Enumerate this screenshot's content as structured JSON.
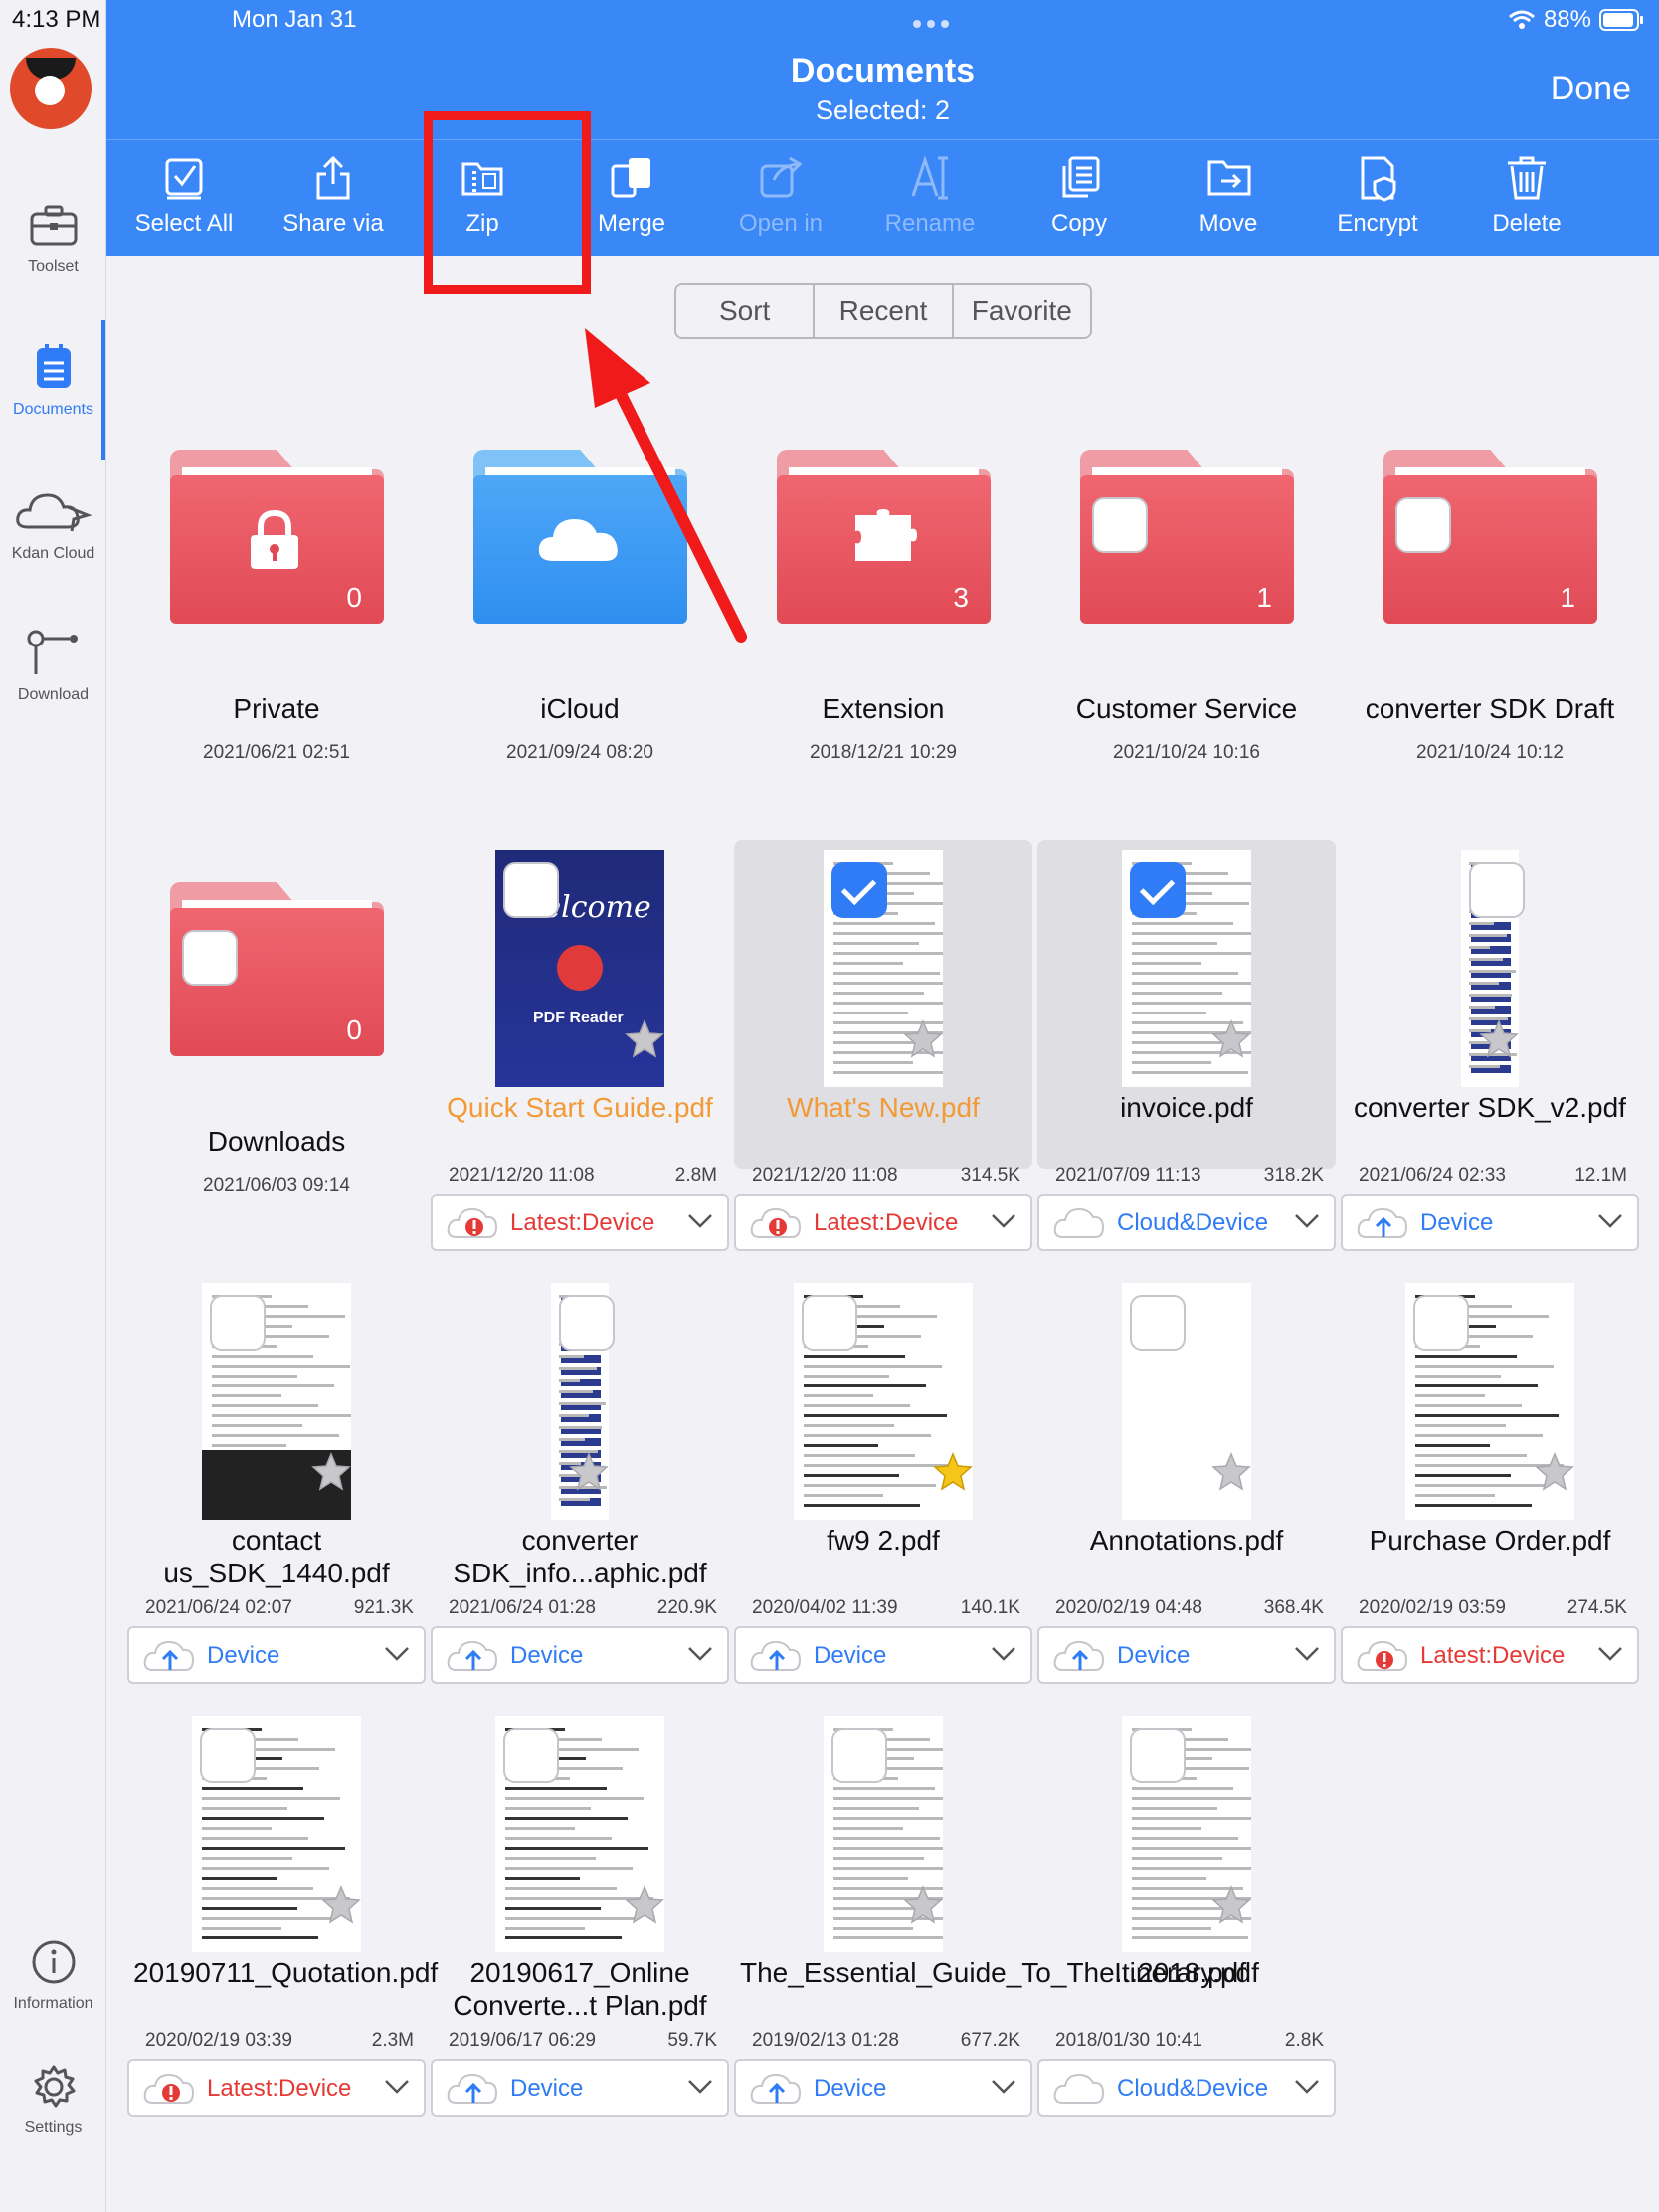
{
  "status_bar": {
    "time": "4:13 PM",
    "date": "Mon Jan 31",
    "battery": "88%"
  },
  "header": {
    "title": "Documents",
    "subtitle": "Selected: 2",
    "done_label": "Done"
  },
  "toolbar": [
    {
      "label": "Select All",
      "icon": "select-all-icon",
      "enabled": true
    },
    {
      "label": "Share via",
      "icon": "share-icon",
      "enabled": true
    },
    {
      "label": "Zip",
      "icon": "zip-icon",
      "enabled": true
    },
    {
      "label": "Merge",
      "icon": "merge-icon",
      "enabled": true
    },
    {
      "label": "Open in",
      "icon": "open-in-icon",
      "enabled": false
    },
    {
      "label": "Rename",
      "icon": "rename-icon",
      "enabled": false
    },
    {
      "label": "Copy",
      "icon": "copy-icon",
      "enabled": true
    },
    {
      "label": "Move",
      "icon": "move-icon",
      "enabled": true
    },
    {
      "label": "Encrypt",
      "icon": "encrypt-icon",
      "enabled": true
    },
    {
      "label": "Delete",
      "icon": "trash-icon",
      "enabled": true
    }
  ],
  "sort_tabs": [
    "Sort",
    "Recent",
    "Favorite"
  ],
  "sidebar": {
    "items": [
      {
        "label": "Toolset",
        "icon": "toolbox-icon"
      },
      {
        "label": "Documents",
        "icon": "documents-icon",
        "active": true
      },
      {
        "label": "Kdan Cloud",
        "icon": "cloud-icon"
      },
      {
        "label": "Download",
        "icon": "download-icon"
      },
      {
        "label": "Information",
        "icon": "info-icon"
      },
      {
        "label": "Settings",
        "icon": "gear-icon"
      }
    ]
  },
  "folders": [
    {
      "name": "Private",
      "date": "2021/06/21 02:51",
      "count": "0",
      "color": "red",
      "icon": "lock-icon"
    },
    {
      "name": "iCloud",
      "date": "2021/09/24 08:20",
      "count": "",
      "color": "blue",
      "icon": "cloud-icon"
    },
    {
      "name": "Extension",
      "date": "2018/12/21 10:29",
      "count": "3",
      "color": "red",
      "icon": "puzzle-icon"
    },
    {
      "name": "Customer Service",
      "date": "2021/10/24 10:16",
      "count": "1",
      "color": "red",
      "icon": "checkbox"
    },
    {
      "name": "converter SDK Draft",
      "date": "2021/10/24 10:12",
      "count": "1",
      "color": "red",
      "icon": "checkbox"
    },
    {
      "name": "Downloads",
      "date": "2021/06/03 09:14",
      "count": "0",
      "color": "red",
      "icon": "checkbox"
    }
  ],
  "files": [
    {
      "name": "Quick Start Guide.pdf",
      "date": "2021/12/20 11:08",
      "size": "2.8M",
      "status": "Latest:Device",
      "status_type": "warn",
      "orange": true,
      "selected": false,
      "favorite": false,
      "thumb": "cover"
    },
    {
      "name": "What's New.pdf",
      "date": "2021/12/20 11:08",
      "size": "314.5K",
      "status": "Latest:Device",
      "status_type": "warn",
      "orange": true,
      "selected": true,
      "favorite": false,
      "thumb": "doc"
    },
    {
      "name": "invoice.pdf",
      "date": "2021/07/09 11:13",
      "size": "318.2K",
      "status": "Cloud&Device",
      "status_type": "cloud",
      "orange": false,
      "selected": true,
      "favorite": false,
      "thumb": "invoice"
    },
    {
      "name": "converter SDK_v2.pdf",
      "date": "2021/06/24 02:33",
      "size": "12.1M",
      "status": "Device",
      "status_type": "device",
      "orange": false,
      "selected": false,
      "favorite": false,
      "thumb": "tall"
    },
    {
      "name": "contact us_SDK_1440.pdf",
      "date": "2021/06/24 02:07",
      "size": "921.3K",
      "status": "Device",
      "status_type": "device",
      "orange": false,
      "selected": false,
      "favorite": false,
      "thumb": "web"
    },
    {
      "name": "converter SDK_info...aphic.pdf",
      "date": "2021/06/24 01:28",
      "size": "220.9K",
      "status": "Device",
      "status_type": "device",
      "orange": false,
      "selected": false,
      "favorite": false,
      "thumb": "tall"
    },
    {
      "name": "fw9 2.pdf",
      "date": "2020/04/02 11:39",
      "size": "140.1K",
      "status": "Device",
      "status_type": "device",
      "orange": false,
      "selected": false,
      "favorite": true,
      "thumb": "form"
    },
    {
      "name": "Annotations.pdf",
      "date": "2020/02/19 04:48",
      "size": "368.4K",
      "status": "Device",
      "status_type": "device",
      "orange": false,
      "selected": false,
      "favorite": false,
      "thumb": "blank"
    },
    {
      "name": "Purchase Order.pdf",
      "date": "2020/02/19 03:59",
      "size": "274.5K",
      "status": "Latest:Device",
      "status_type": "warn",
      "orange": false,
      "selected": false,
      "favorite": false,
      "thumb": "table"
    },
    {
      "name": "20190711_Quotation.pdf",
      "date": "2020/02/19 03:39",
      "size": "2.3M",
      "status": "Latest:Device",
      "status_type": "warn",
      "orange": false,
      "selected": false,
      "favorite": false,
      "thumb": "table"
    },
    {
      "name": "20190617_Online Converte...t Plan.pdf",
      "date": "2019/06/17 06:29",
      "size": "59.7K",
      "status": "Device",
      "status_type": "device",
      "orange": false,
      "selected": false,
      "favorite": false,
      "thumb": "table"
    },
    {
      "name": "The_Essential_Guide_To_The...2018.pdf",
      "date": "2019/02/13 01:28",
      "size": "677.2K",
      "status": "Device",
      "status_type": "device",
      "orange": false,
      "selected": false,
      "favorite": false,
      "thumb": "doc"
    },
    {
      "name": "Itinerary.pdf",
      "date": "2018/01/30 10:41",
      "size": "2.8K",
      "status": "Cloud&Device",
      "status_type": "cloud",
      "orange": false,
      "selected": false,
      "favorite": false,
      "thumb": "invoice"
    }
  ],
  "colors": {
    "accent": "#3a87f7",
    "warn": "#e53935",
    "highlight": "#f01a1a",
    "star_favorite": "#f5c518"
  }
}
